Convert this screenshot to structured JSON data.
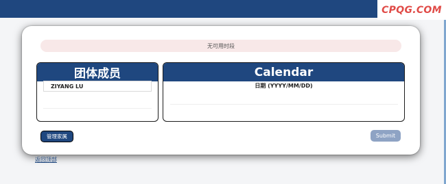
{
  "brand": {
    "logo_text": "CPQG.COM"
  },
  "alert": {
    "text": "无可用时段"
  },
  "members": {
    "title": "团体成员",
    "items": [
      {
        "name": "ZIYANG LU"
      }
    ]
  },
  "calendar": {
    "title": "Calendar",
    "date_label": "日期 (YYYY/MM/DD)"
  },
  "actions": {
    "manage_label": "管理家属",
    "submit_label": "Submit"
  },
  "footer": {
    "back_link": "返回顶部"
  },
  "colors": {
    "primary": "#1f477f",
    "alert_bg": "#f8e8e8",
    "submit_disabled": "#8ea3c4",
    "logo": "#e04b47"
  }
}
